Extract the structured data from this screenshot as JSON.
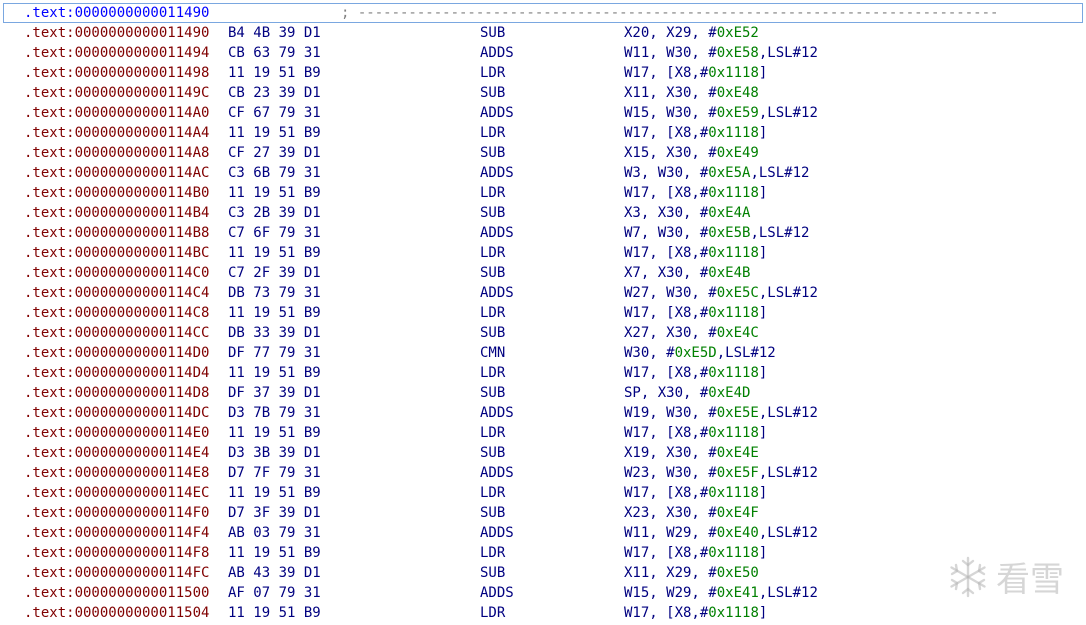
{
  "header_row": {
    "segment": ".text:",
    "address": "0000000000011490",
    "comment": "; ----------------------------------------------------------------------------"
  },
  "rows": [
    {
      "segment": ".text:",
      "address": "0000000000011490",
      "bytes": "B4 4B 39 D1",
      "mnemonic": "SUB",
      "ops_pre": "X20, X29, #",
      "imm": "0xE52",
      "ops_post": ""
    },
    {
      "segment": ".text:",
      "address": "0000000000011494",
      "bytes": "CB 63 79 31",
      "mnemonic": "ADDS",
      "ops_pre": "W11, W30, #",
      "imm": "0xE58",
      "ops_post": ",LSL#12"
    },
    {
      "segment": ".text:",
      "address": "0000000000011498",
      "bytes": "11 19 51 B9",
      "mnemonic": "LDR",
      "ops_pre": "W17, [X8,#",
      "imm": "0x1118",
      "ops_post": "]"
    },
    {
      "segment": ".text:",
      "address": "000000000001149C",
      "bytes": "CB 23 39 D1",
      "mnemonic": "SUB",
      "ops_pre": "X11, X30, #",
      "imm": "0xE48",
      "ops_post": ""
    },
    {
      "segment": ".text:",
      "address": "00000000000114A0",
      "bytes": "CF 67 79 31",
      "mnemonic": "ADDS",
      "ops_pre": "W15, W30, #",
      "imm": "0xE59",
      "ops_post": ",LSL#12"
    },
    {
      "segment": ".text:",
      "address": "00000000000114A4",
      "bytes": "11 19 51 B9",
      "mnemonic": "LDR",
      "ops_pre": "W17, [X8,#",
      "imm": "0x1118",
      "ops_post": "]"
    },
    {
      "segment": ".text:",
      "address": "00000000000114A8",
      "bytes": "CF 27 39 D1",
      "mnemonic": "SUB",
      "ops_pre": "X15, X30, #",
      "imm": "0xE49",
      "ops_post": ""
    },
    {
      "segment": ".text:",
      "address": "00000000000114AC",
      "bytes": "C3 6B 79 31",
      "mnemonic": "ADDS",
      "ops_pre": "W3, W30, #",
      "imm": "0xE5A",
      "ops_post": ",LSL#12"
    },
    {
      "segment": ".text:",
      "address": "00000000000114B0",
      "bytes": "11 19 51 B9",
      "mnemonic": "LDR",
      "ops_pre": "W17, [X8,#",
      "imm": "0x1118",
      "ops_post": "]"
    },
    {
      "segment": ".text:",
      "address": "00000000000114B4",
      "bytes": "C3 2B 39 D1",
      "mnemonic": "SUB",
      "ops_pre": "X3, X30, #",
      "imm": "0xE4A",
      "ops_post": ""
    },
    {
      "segment": ".text:",
      "address": "00000000000114B8",
      "bytes": "C7 6F 79 31",
      "mnemonic": "ADDS",
      "ops_pre": "W7, W30, #",
      "imm": "0xE5B",
      "ops_post": ",LSL#12"
    },
    {
      "segment": ".text:",
      "address": "00000000000114BC",
      "bytes": "11 19 51 B9",
      "mnemonic": "LDR",
      "ops_pre": "W17, [X8,#",
      "imm": "0x1118",
      "ops_post": "]"
    },
    {
      "segment": ".text:",
      "address": "00000000000114C0",
      "bytes": "C7 2F 39 D1",
      "mnemonic": "SUB",
      "ops_pre": "X7, X30, #",
      "imm": "0xE4B",
      "ops_post": ""
    },
    {
      "segment": ".text:",
      "address": "00000000000114C4",
      "bytes": "DB 73 79 31",
      "mnemonic": "ADDS",
      "ops_pre": "W27, W30, #",
      "imm": "0xE5C",
      "ops_post": ",LSL#12"
    },
    {
      "segment": ".text:",
      "address": "00000000000114C8",
      "bytes": "11 19 51 B9",
      "mnemonic": "LDR",
      "ops_pre": "W17, [X8,#",
      "imm": "0x1118",
      "ops_post": "]"
    },
    {
      "segment": ".text:",
      "address": "00000000000114CC",
      "bytes": "DB 33 39 D1",
      "mnemonic": "SUB",
      "ops_pre": "X27, X30, #",
      "imm": "0xE4C",
      "ops_post": ""
    },
    {
      "segment": ".text:",
      "address": "00000000000114D0",
      "bytes": "DF 77 79 31",
      "mnemonic": "CMN",
      "ops_pre": "W30, #",
      "imm": "0xE5D",
      "ops_post": ",LSL#12"
    },
    {
      "segment": ".text:",
      "address": "00000000000114D4",
      "bytes": "11 19 51 B9",
      "mnemonic": "LDR",
      "ops_pre": "W17, [X8,#",
      "imm": "0x1118",
      "ops_post": "]"
    },
    {
      "segment": ".text:",
      "address": "00000000000114D8",
      "bytes": "DF 37 39 D1",
      "mnemonic": "SUB",
      "ops_pre": "SP, X30, #",
      "imm": "0xE4D",
      "ops_post": ""
    },
    {
      "segment": ".text:",
      "address": "00000000000114DC",
      "bytes": "D3 7B 79 31",
      "mnemonic": "ADDS",
      "ops_pre": "W19, W30, #",
      "imm": "0xE5E",
      "ops_post": ",LSL#12"
    },
    {
      "segment": ".text:",
      "address": "00000000000114E0",
      "bytes": "11 19 51 B9",
      "mnemonic": "LDR",
      "ops_pre": "W17, [X8,#",
      "imm": "0x1118",
      "ops_post": "]"
    },
    {
      "segment": ".text:",
      "address": "00000000000114E4",
      "bytes": "D3 3B 39 D1",
      "mnemonic": "SUB",
      "ops_pre": "X19, X30, #",
      "imm": "0xE4E",
      "ops_post": ""
    },
    {
      "segment": ".text:",
      "address": "00000000000114E8",
      "bytes": "D7 7F 79 31",
      "mnemonic": "ADDS",
      "ops_pre": "W23, W30, #",
      "imm": "0xE5F",
      "ops_post": ",LSL#12"
    },
    {
      "segment": ".text:",
      "address": "00000000000114EC",
      "bytes": "11 19 51 B9",
      "mnemonic": "LDR",
      "ops_pre": "W17, [X8,#",
      "imm": "0x1118",
      "ops_post": "]"
    },
    {
      "segment": ".text:",
      "address": "00000000000114F0",
      "bytes": "D7 3F 39 D1",
      "mnemonic": "SUB",
      "ops_pre": "X23, X30, #",
      "imm": "0xE4F",
      "ops_post": ""
    },
    {
      "segment": ".text:",
      "address": "00000000000114F4",
      "bytes": "AB 03 79 31",
      "mnemonic": "ADDS",
      "ops_pre": "W11, W29, #",
      "imm": "0xE40",
      "ops_post": ",LSL#12"
    },
    {
      "segment": ".text:",
      "address": "00000000000114F8",
      "bytes": "11 19 51 B9",
      "mnemonic": "LDR",
      "ops_pre": "W17, [X8,#",
      "imm": "0x1118",
      "ops_post": "]"
    },
    {
      "segment": ".text:",
      "address": "00000000000114FC",
      "bytes": "AB 43 39 D1",
      "mnemonic": "SUB",
      "ops_pre": "X11, X29, #",
      "imm": "0xE50",
      "ops_post": ""
    },
    {
      "segment": ".text:",
      "address": "0000000000011500",
      "bytes": "AF 07 79 31",
      "mnemonic": "ADDS",
      "ops_pre": "W15, W29, #",
      "imm": "0xE41",
      "ops_post": ",LSL#12"
    },
    {
      "segment": ".text:",
      "address": "0000000000011504",
      "bytes": "11 19 51 B9",
      "mnemonic": "LDR",
      "ops_pre": "W17, [X8,#",
      "imm": "0x1118",
      "ops_post": "]"
    }
  ],
  "watermark": {
    "text": "看雪",
    "icon": "snowflake-icon"
  },
  "colors": {
    "segment": "#800000",
    "address_selected": "#0000ff",
    "instruction": "#000080",
    "immediate": "#008000",
    "comment": "#808080"
  }
}
